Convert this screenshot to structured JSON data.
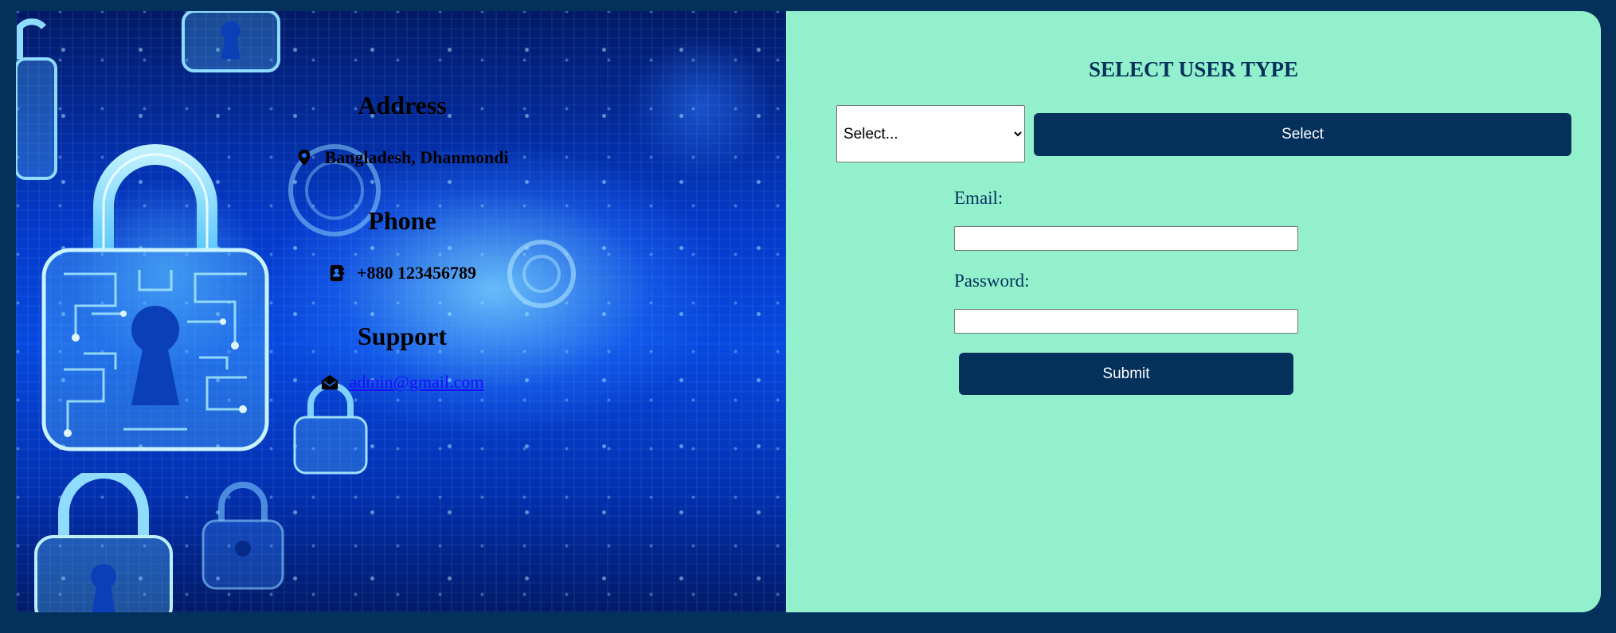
{
  "contact": {
    "address_heading": "Address",
    "address_text": "Bangladesh, Dhanmondi",
    "phone_heading": "Phone",
    "phone_text": "+880 123456789",
    "support_heading": "Support",
    "support_email": "admin@gmail.com"
  },
  "form": {
    "title": "SELECT USER TYPE",
    "user_type_selected": "Select...",
    "select_button_label": "Select",
    "email_label": "Email:",
    "email_value": "",
    "password_label": "Password:",
    "password_value": "",
    "submit_label": "Submit"
  },
  "colors": {
    "page_background": "#04315c",
    "form_background": "#93f0cc",
    "button_background": "#04315c",
    "link": "#1a0dff"
  },
  "icons": {
    "address": "map-pin-icon",
    "phone": "address-book-icon",
    "support": "envelope-open-icon"
  }
}
